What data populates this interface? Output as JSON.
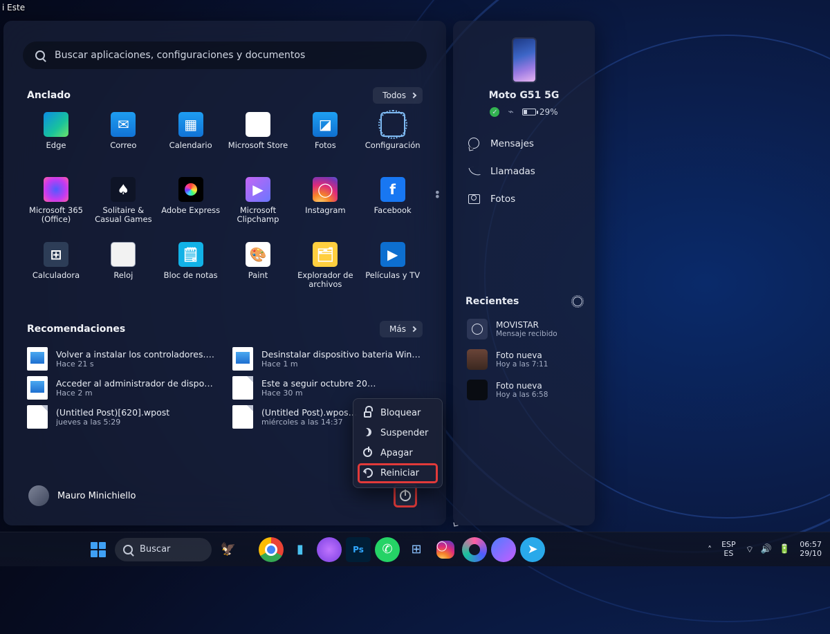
{
  "desktop": {
    "label_fragment": "i Este"
  },
  "start": {
    "search_placeholder": "Buscar aplicaciones, configuraciones y documentos",
    "pinned": {
      "title": "Anclado",
      "all_label": "Todos",
      "items": [
        {
          "label": "Edge"
        },
        {
          "label": "Correo"
        },
        {
          "label": "Calendario"
        },
        {
          "label": "Microsoft Store"
        },
        {
          "label": "Fotos"
        },
        {
          "label": "Configuración"
        },
        {
          "label": "Microsoft 365 (Office)"
        },
        {
          "label": "Solitaire & Casual Games"
        },
        {
          "label": "Adobe Express"
        },
        {
          "label": "Microsoft Clipchamp"
        },
        {
          "label": "Instagram"
        },
        {
          "label": "Facebook"
        },
        {
          "label": "Calculadora"
        },
        {
          "label": "Reloj"
        },
        {
          "label": "Bloc de notas"
        },
        {
          "label": "Paint"
        },
        {
          "label": "Explorador de archivos"
        },
        {
          "label": "Películas y TV"
        }
      ]
    },
    "reco": {
      "title": "Recomendaciones",
      "more_label": "Más",
      "items": [
        {
          "title": "Volver a instalar los controladores.j…",
          "sub": "Hace 21 s",
          "kind": "img"
        },
        {
          "title": "Desinstalar dispositivo bateria Win…",
          "sub": "Hace 1 m",
          "kind": "img"
        },
        {
          "title": "Acceder al administrador de dispos…",
          "sub": "Hace 2 m",
          "kind": "img"
        },
        {
          "title": "Este a seguir octubre 20…",
          "sub": "Hace 30 m",
          "kind": "doc"
        },
        {
          "title": "(Untitled Post)[620].wpost",
          "sub": "jueves a las 5:29",
          "kind": "doc"
        },
        {
          "title": "(Untitled Post).wpos…",
          "sub": "miércoles a las 14:37",
          "kind": "doc"
        }
      ]
    },
    "user": {
      "name": "Mauro Minichiello"
    },
    "power_menu": {
      "items": [
        {
          "label": "Bloquear",
          "icon": "lock"
        },
        {
          "label": "Suspender",
          "icon": "moon"
        },
        {
          "label": "Apagar",
          "icon": "power"
        },
        {
          "label": "Reiniciar",
          "icon": "restart",
          "highlight": true
        }
      ]
    }
  },
  "side": {
    "device_name": "Moto G51 5G",
    "battery": "29%",
    "links": [
      {
        "label": "Mensajes",
        "icon": "msg"
      },
      {
        "label": "Llamadas",
        "icon": "call"
      },
      {
        "label": "Fotos",
        "icon": "photo"
      }
    ],
    "recent_title": "Recientes",
    "recent": [
      {
        "title": "MOVISTAR",
        "sub": "Mensaje recibido",
        "kind": "msg"
      },
      {
        "title": "Foto nueva",
        "sub": "Hoy a las 7:11",
        "kind": "p1"
      },
      {
        "title": "Foto nueva",
        "sub": "Hoy a las 6:58",
        "kind": "p2"
      }
    ]
  },
  "taskbar": {
    "search_placeholder": "Buscar",
    "lang1": "ESP",
    "lang2": "ES",
    "time": "06:57",
    "date": "29/10"
  }
}
